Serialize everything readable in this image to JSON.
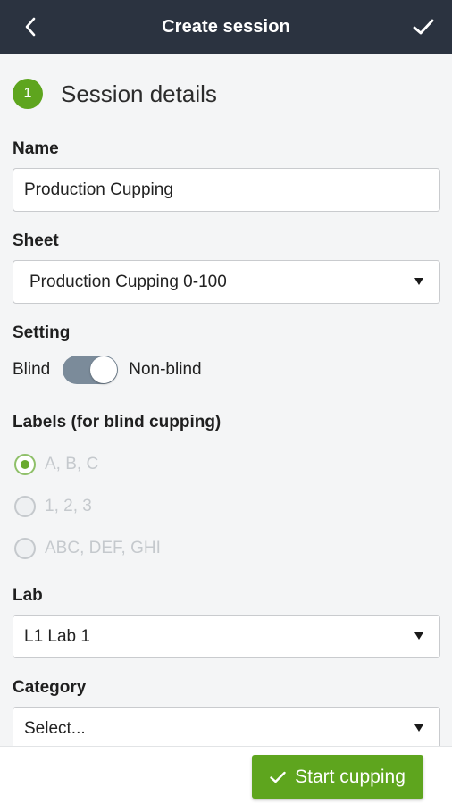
{
  "header": {
    "title": "Create session",
    "back_icon": "chevron-left-icon",
    "confirm_icon": "checkmark-icon"
  },
  "section": {
    "step": "1",
    "title": "Session details"
  },
  "form": {
    "name_label": "Name",
    "name_value": "Production Cupping",
    "sheet_label": "Sheet",
    "sheet_value": "Production Cupping 0-100",
    "setting_label": "Setting",
    "setting_left": "Blind",
    "setting_right": "Non-blind",
    "setting_non_blind_on": true,
    "labels_label": "Labels (for blind cupping)",
    "label_options": [
      "A, B, C",
      "1, 2, 3",
      "ABC, DEF, GHI"
    ],
    "label_selected": "A, B, C",
    "lab_label": "Lab",
    "lab_value": "L1 Lab 1",
    "category_label": "Category",
    "category_value": "Select..."
  },
  "footer": {
    "start_label": "Start cupping",
    "start_icon": "checkmark-icon"
  },
  "colors": {
    "header_bg": "#2b3340",
    "accent_green": "#5ea51e",
    "toggle_track": "#7b8b9a"
  }
}
